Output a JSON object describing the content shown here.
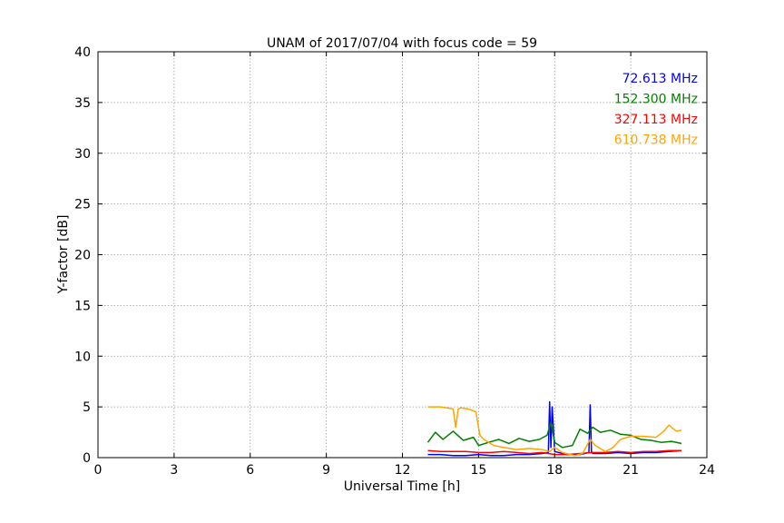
{
  "chart_data": {
    "type": "line",
    "title": "UNAM of 2017/07/04 with focus code = 59",
    "xlabel": "Universal Time [h]",
    "ylabel": "Y-factor [dB]",
    "xlim": [
      0,
      24
    ],
    "ylim": [
      0,
      40
    ],
    "xticks": [
      0,
      3,
      6,
      9,
      12,
      15,
      18,
      21,
      24
    ],
    "yticks": [
      0,
      5,
      10,
      15,
      20,
      25,
      30,
      35,
      40
    ],
    "grid": true,
    "legend_placement": "top-right",
    "series": [
      {
        "name": "72.613 MHz",
        "color": "#0000ff",
        "x": [
          13.0,
          13.5,
          14.0,
          14.5,
          15.0,
          15.5,
          16.0,
          16.5,
          17.0,
          17.5,
          17.75,
          17.8,
          17.85,
          17.9,
          18.0,
          18.5,
          19.0,
          19.35,
          19.4,
          19.45,
          19.5,
          20.0,
          20.5,
          21.0,
          21.5,
          22.0,
          22.5,
          23.0
        ],
        "values": [
          0.3,
          0.3,
          0.2,
          0.2,
          0.3,
          0.2,
          0.2,
          0.3,
          0.3,
          0.4,
          0.5,
          5.5,
          1.0,
          5.0,
          0.6,
          0.3,
          0.3,
          0.5,
          5.2,
          0.6,
          0.4,
          0.4,
          0.5,
          0.4,
          0.5,
          0.5,
          0.6,
          0.7
        ]
      },
      {
        "name": "152.300 MHz",
        "color": "#008000",
        "x": [
          13.0,
          13.3,
          13.6,
          14.0,
          14.4,
          14.8,
          15.0,
          15.4,
          15.8,
          16.2,
          16.6,
          17.0,
          17.4,
          17.7,
          17.85,
          18.0,
          18.3,
          18.7,
          19.0,
          19.3,
          19.5,
          19.8,
          20.2,
          20.6,
          21.0,
          21.4,
          21.8,
          22.2,
          22.6,
          23.0
        ],
        "values": [
          1.5,
          2.5,
          1.8,
          2.6,
          1.7,
          2.0,
          1.2,
          1.5,
          1.8,
          1.4,
          1.9,
          1.6,
          1.8,
          2.2,
          3.5,
          1.5,
          1.0,
          1.2,
          2.8,
          2.4,
          3.0,
          2.5,
          2.7,
          2.3,
          2.2,
          1.8,
          1.7,
          1.5,
          1.6,
          1.4
        ]
      },
      {
        "name": "327.113 MHz",
        "color": "#ff0000",
        "x": [
          13.0,
          13.5,
          14.0,
          14.5,
          15.0,
          15.5,
          16.0,
          16.5,
          17.0,
          17.5,
          18.0,
          18.5,
          19.0,
          19.5,
          20.0,
          20.5,
          21.0,
          21.5,
          22.0,
          22.5,
          23.0
        ],
        "values": [
          0.7,
          0.6,
          0.6,
          0.6,
          0.5,
          0.5,
          0.6,
          0.5,
          0.4,
          0.5,
          0.3,
          0.3,
          0.4,
          0.5,
          0.5,
          0.6,
          0.5,
          0.6,
          0.6,
          0.7,
          0.7
        ]
      },
      {
        "name": "610.738 MHz",
        "color": "#ffa500",
        "x": [
          13.0,
          13.5,
          14.0,
          14.1,
          14.2,
          14.3,
          14.6,
          14.9,
          15.05,
          15.2,
          15.6,
          16.0,
          16.5,
          17.0,
          17.5,
          17.8,
          18.0,
          18.3,
          18.8,
          19.1,
          19.4,
          19.6,
          20.0,
          20.3,
          20.6,
          21.0,
          21.5,
          22.0,
          22.3,
          22.5,
          22.8,
          23.0
        ],
        "values": [
          5.0,
          5.0,
          4.8,
          3.0,
          4.8,
          4.9,
          4.8,
          4.5,
          2.2,
          1.8,
          1.2,
          1.0,
          0.8,
          0.9,
          0.8,
          0.6,
          1.0,
          0.5,
          0.2,
          0.4,
          1.8,
          1.2,
          0.6,
          1.0,
          1.8,
          2.1,
          2.1,
          2.0,
          2.6,
          3.2,
          2.6,
          2.7
        ]
      }
    ]
  }
}
